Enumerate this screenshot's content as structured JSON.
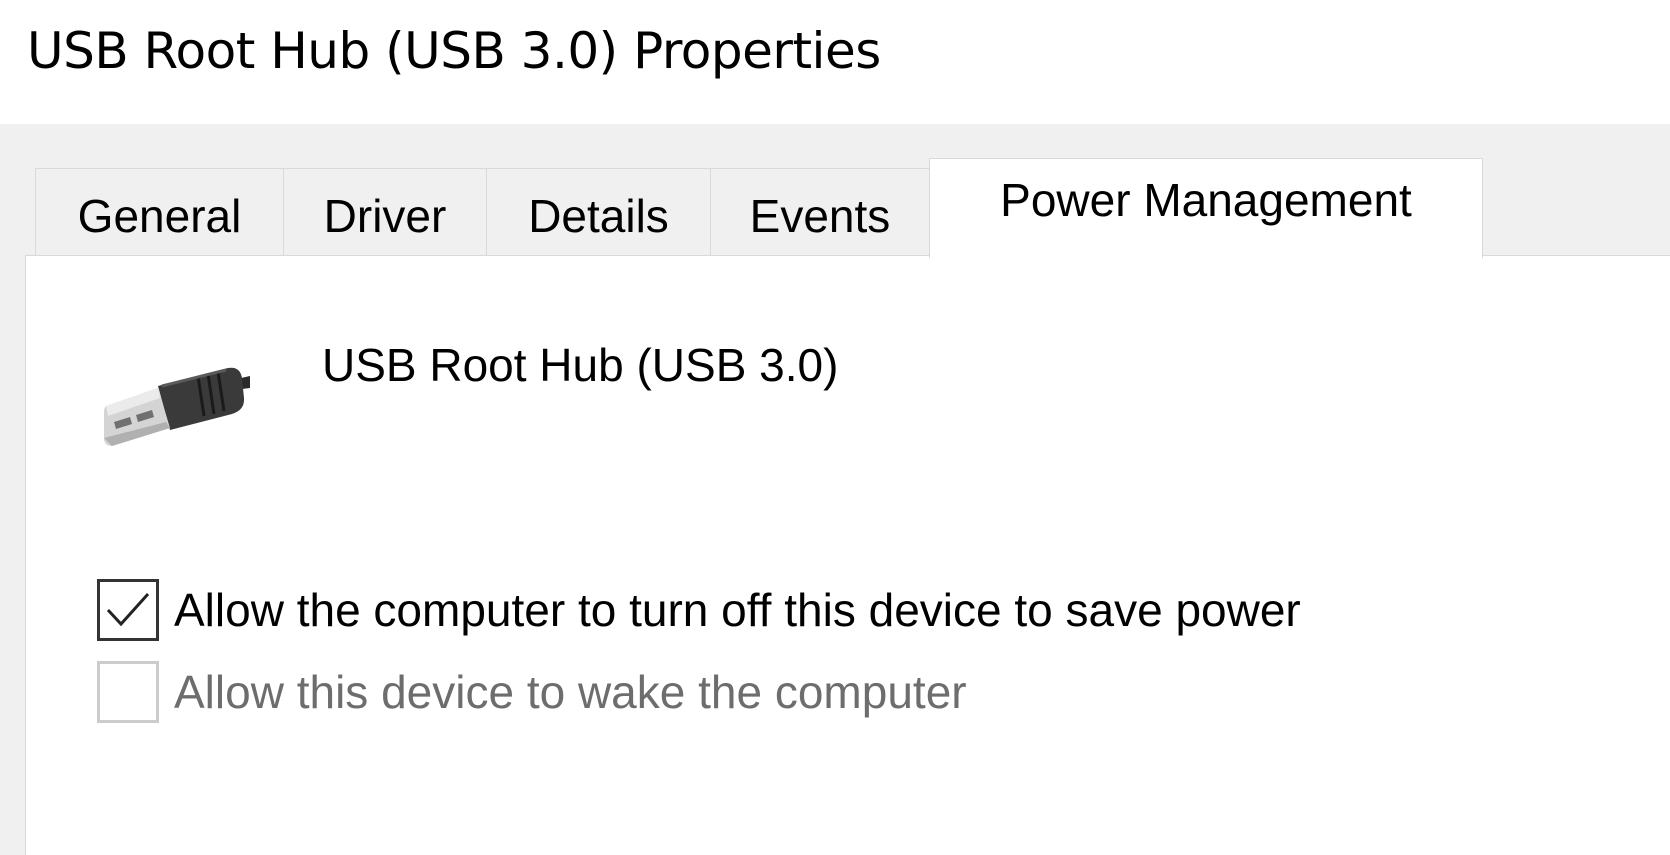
{
  "window": {
    "title": "USB Root Hub (USB 3.0) Properties"
  },
  "tabs": [
    {
      "label": "General",
      "active": false
    },
    {
      "label": "Driver",
      "active": false
    },
    {
      "label": "Details",
      "active": false
    },
    {
      "label": "Events",
      "active": false
    },
    {
      "label": "Power Management",
      "active": true
    }
  ],
  "device": {
    "name": "USB Root Hub (USB 3.0)",
    "icon": "usb-plug-icon"
  },
  "options": [
    {
      "label": "Allow the computer to turn off this device to save power",
      "checked": true,
      "enabled": true
    },
    {
      "label": "Allow this device to wake the computer",
      "checked": false,
      "enabled": false
    }
  ],
  "colors": {
    "window_background": "#f0f0f0",
    "panel_background": "#ffffff",
    "disabled_text": "#6d6d6d",
    "tab_border": "#d9d9d9"
  }
}
